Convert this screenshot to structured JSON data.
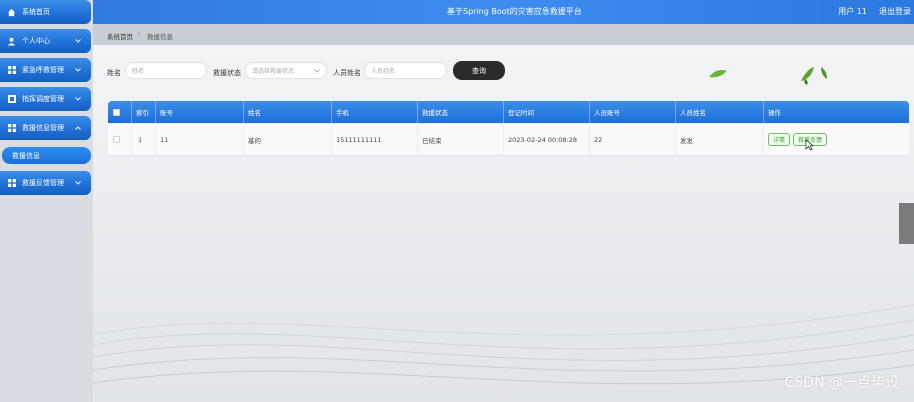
{
  "sidebar": {
    "items": [
      {
        "label": "系统首页",
        "icon": "home-icon",
        "expandable": false
      },
      {
        "label": "个人中心",
        "icon": "user-icon",
        "expandable": true
      },
      {
        "label": "紧急呼救管理",
        "icon": "grid-icon",
        "expandable": true
      },
      {
        "label": "指挥调度管理",
        "icon": "grid-icon",
        "expandable": true
      },
      {
        "label": "救援信息管理",
        "icon": "grid-icon",
        "expandable": true,
        "expanded": true
      },
      {
        "label": "救援反馈管理",
        "icon": "grid-icon",
        "expandable": true
      }
    ],
    "active_sub": "救援信息"
  },
  "header": {
    "title": "基于Spring Boot的灾害应急救援平台",
    "user": "用户 11",
    "logout": "退出登录"
  },
  "breadcrumb": {
    "home": "系统首页",
    "current": "救援信息"
  },
  "search": {
    "name_label": "姓名",
    "name_placeholder": "姓名",
    "status_label": "救援状态",
    "status_placeholder": "请选择救援状态",
    "person_label": "人员姓名",
    "person_placeholder": "人员姓名",
    "query_button": "查询"
  },
  "table": {
    "headers": [
      "索引",
      "账号",
      "姓名",
      "手机",
      "救援状态",
      "登记时间",
      "人员账号",
      "人员姓名",
      "操作"
    ],
    "rows": [
      {
        "index": "1",
        "account": "11",
        "name": "基的",
        "phone": "15111111111",
        "status": "已结束",
        "time": "2023-02-24 00:08:28",
        "staff_account": "22",
        "staff_name": "发发",
        "actions": [
          "详情",
          "救援反馈"
        ]
      }
    ]
  },
  "watermark": "CSDN @一点毕设",
  "colors": {
    "primary_blue": "#1e6fd8",
    "action_green": "#6cc15e",
    "query_button": "#2b2b2b"
  }
}
